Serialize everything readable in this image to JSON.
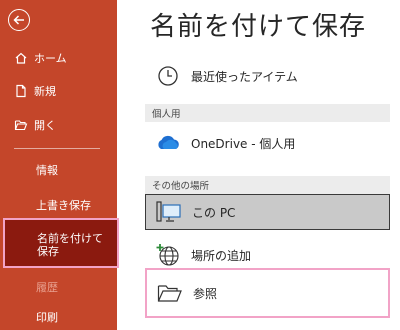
{
  "sidebar": {
    "back_icon": "back-arrow-icon",
    "items": [
      {
        "id": "home",
        "label": "ホーム",
        "icon": "home-icon"
      },
      {
        "id": "new",
        "label": "新規",
        "icon": "new-file-icon"
      },
      {
        "id": "open",
        "label": "開く",
        "icon": "folder-open-icon"
      },
      {
        "id": "info",
        "label": "情報"
      },
      {
        "id": "save",
        "label": "上書き保存"
      },
      {
        "id": "save-as",
        "label": "名前を付けて保存",
        "selected": true
      },
      {
        "id": "history",
        "label": "履歴",
        "disabled": true
      },
      {
        "id": "print",
        "label": "印刷"
      }
    ]
  },
  "main": {
    "title": "名前を付けて保存",
    "recent": {
      "label": "最近使ったアイテム",
      "icon": "clock-icon"
    },
    "sections": {
      "personal": "個人用",
      "other": "その他の場所"
    },
    "onedrive": {
      "label": "OneDrive - 個人用",
      "icon": "cloud-icon"
    },
    "this_pc": {
      "label": "この PC",
      "icon": "computer-icon"
    },
    "add_place": {
      "label": "場所の追加",
      "icon": "globe-plus-icon"
    },
    "browse": {
      "label": "参照",
      "icon": "folder-icon"
    }
  },
  "colors": {
    "sidebar_bg": "#c4462a",
    "selected_bg": "#8b1a0f",
    "highlight_border": "#f2a3c7",
    "this_pc_bg": "#c9c9c9"
  }
}
